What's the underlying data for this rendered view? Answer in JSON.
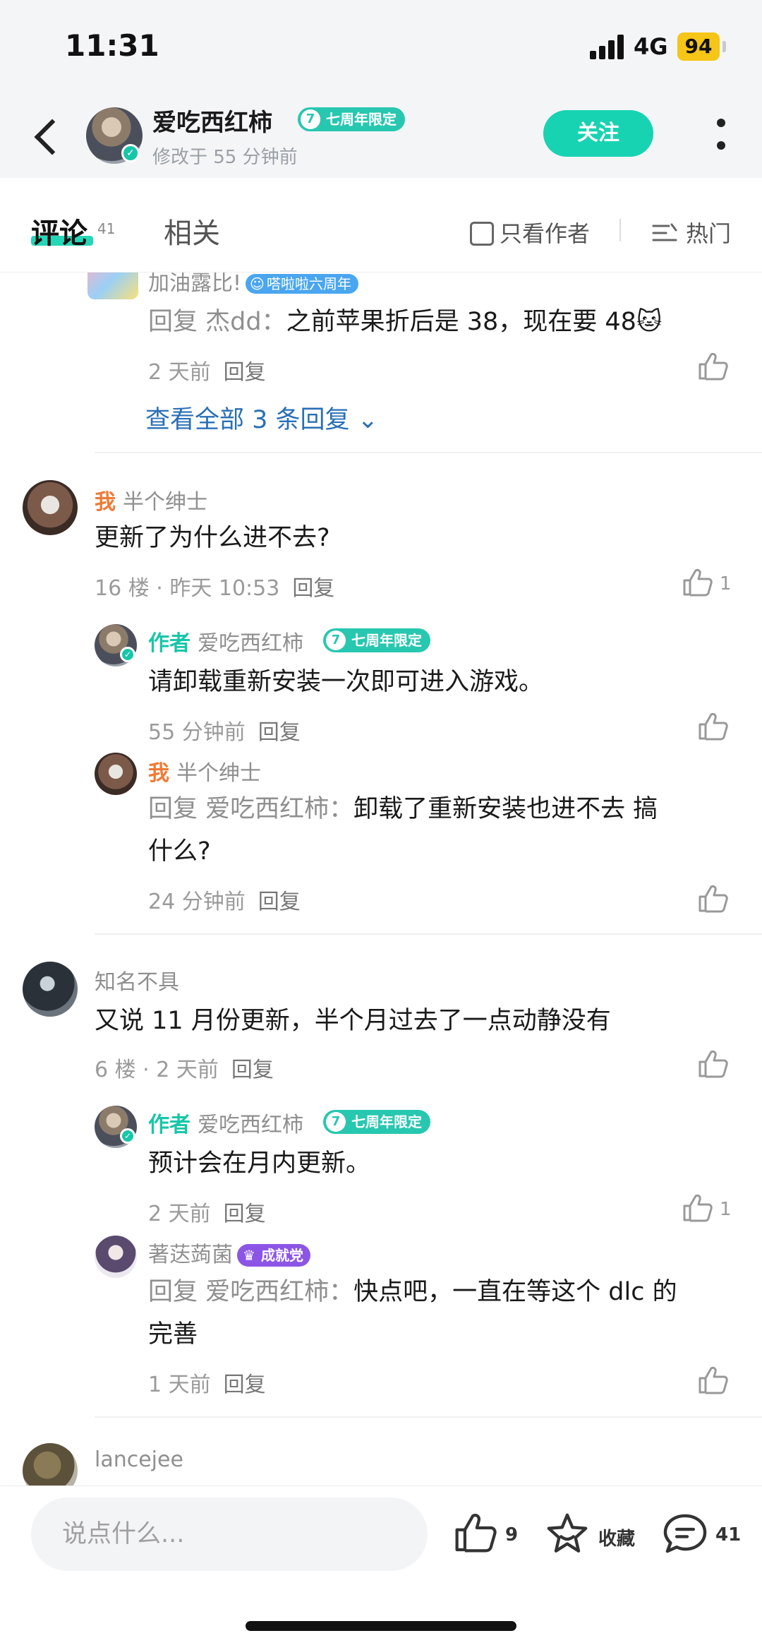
{
  "status": {
    "time": "11:31",
    "network": "4G",
    "battery": "94"
  },
  "header": {
    "author_name": "爱吃西红柿",
    "badge": "七周年限定",
    "subtitle": "修改于 55 分钟前",
    "follow_label": "关注"
  },
  "tabs": {
    "active": "评论",
    "active_count": "41",
    "inactive": "相关",
    "author_only": "只看作者",
    "sort": "热门"
  },
  "comments": {
    "top_reply": {
      "name": "加油露比!",
      "badge": "嗒啦啦六周年",
      "prefix": "回复 杰dd：",
      "text": "之前苹果折后是 38，现在要 48",
      "emoji": "🐱",
      "time": "2 天前",
      "reply_label": "回复",
      "view_all": "查看全部 3 条回复"
    },
    "c1": {
      "tag": "我",
      "name": "半个绅士",
      "text": "更新了为什么进不去?",
      "meta": "16 楼 · 昨天 10:53",
      "reply_label": "回复",
      "likes": "1",
      "replies": [
        {
          "tag": "作者",
          "name": "爱吃西红柿",
          "badge": "七周年限定",
          "text": "请卸载重新安装一次即可进入游戏。",
          "time": "55 分钟前",
          "reply_label": "回复"
        },
        {
          "tag": "我",
          "name": "半个绅士",
          "prefix": "回复 爱吃西红柿：",
          "text_line1": "卸载了重新安装也进不去 搞",
          "text_line2": "什么?",
          "time": "24 分钟前",
          "reply_label": "回复"
        }
      ]
    },
    "c2": {
      "name": "知名不具",
      "text": "又说 11 月份更新，半个月过去了一点动静没有",
      "meta": "6 楼 · 2 天前",
      "reply_label": "回复",
      "replies": [
        {
          "tag": "作者",
          "name": "爱吃西红柿",
          "badge": "七周年限定",
          "text": "预计会在月内更新。",
          "time": "2 天前",
          "reply_label": "回复",
          "likes": "1"
        },
        {
          "name": "著荙蒟菌",
          "badge": "成就党",
          "prefix": "回复 爱吃西红柿：",
          "text_line1": "快点吧，一直在等这个 dlc 的",
          "text_line2": "完善",
          "time": "1 天前",
          "reply_label": "回复"
        }
      ]
    },
    "c3": {
      "name": "lancejee"
    }
  },
  "bottombar": {
    "placeholder": "说点什么...",
    "likes": "9",
    "favorite_label": "收藏",
    "comments": "41"
  },
  "colors": {
    "accent": "#17d3b2",
    "me_tag": "#f07a35",
    "link": "#2a6fb5"
  },
  "icons": [
    "back-icon",
    "more-icon",
    "checkbox-icon",
    "sort-icon",
    "thumb-up-icon",
    "star-icon",
    "comment-icon",
    "verified-icon"
  ]
}
